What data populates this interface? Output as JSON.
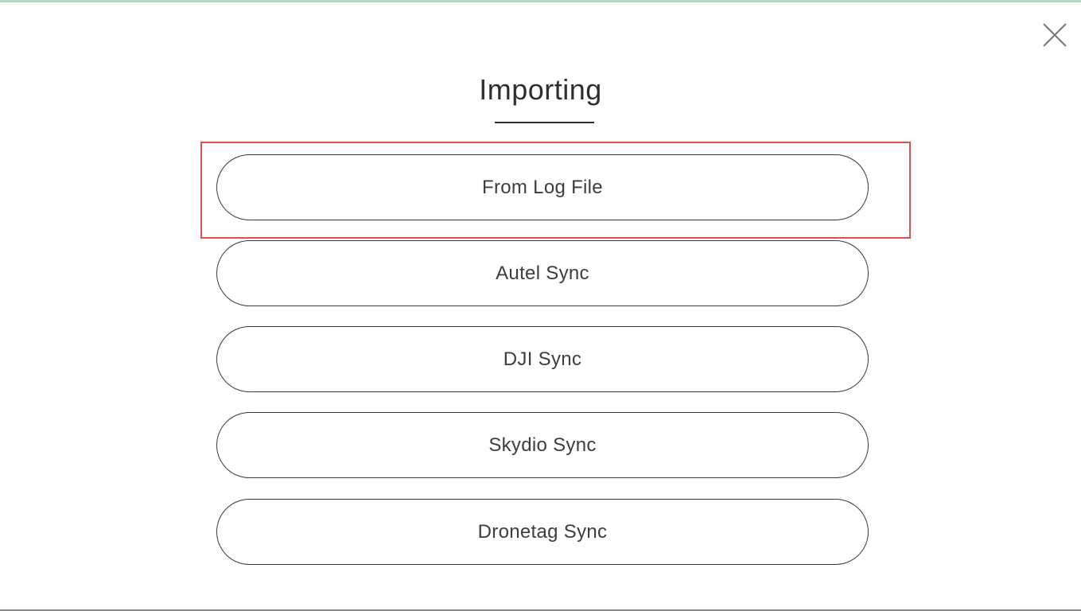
{
  "dialog": {
    "title": "Importing",
    "close_icon": "close-icon"
  },
  "options": [
    {
      "label": "From Log File",
      "highlighted": true
    },
    {
      "label": "Autel Sync"
    },
    {
      "label": "DJI Sync"
    },
    {
      "label": "Skydio Sync"
    },
    {
      "label": "Dronetag Sync"
    }
  ],
  "colors": {
    "highlight_border": "#d9534f",
    "button_border": "#3a3a3a",
    "text": "#3d3d3d",
    "top_accent": "#b9d8c2"
  }
}
